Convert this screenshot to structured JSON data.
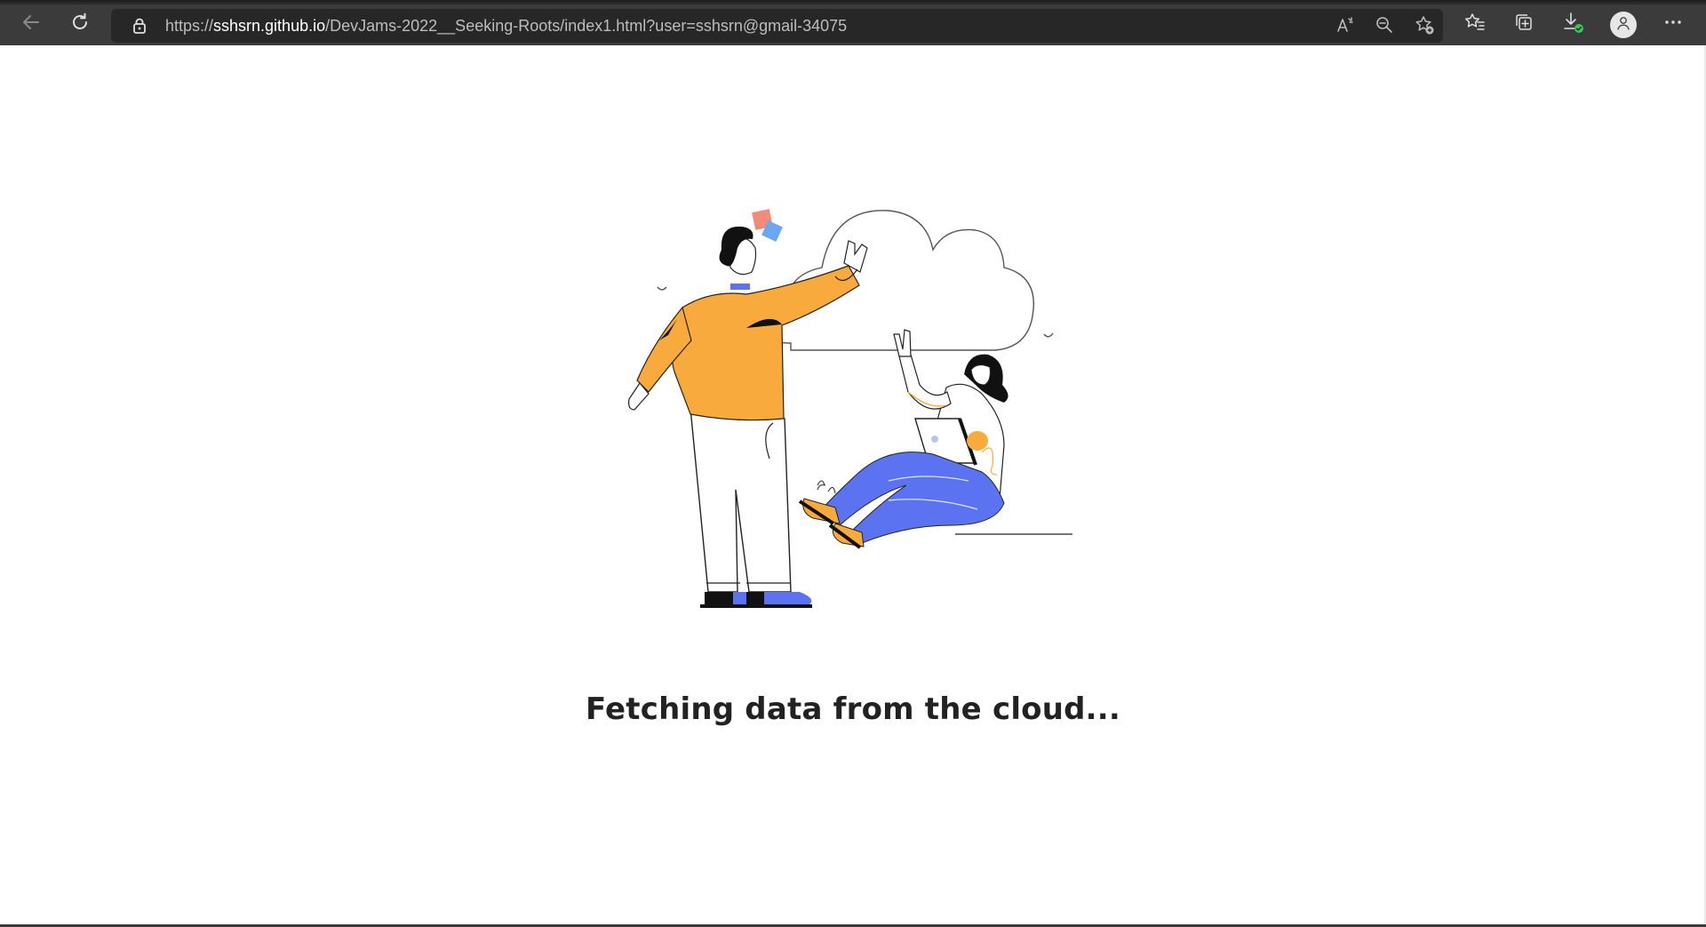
{
  "browser": {
    "url_prefix": "https://",
    "url_host": "sshsrn.github.io",
    "url_path": "/DevJams-2022__Seeking-Roots/index1.html?user=sshsrn@gmail-34075",
    "icons": {
      "back": "arrow-left-icon",
      "refresh": "refresh-icon",
      "lock": "lock-icon",
      "read_aloud": "read-aloud-icon",
      "zoom": "zoom-out-icon",
      "add_favorite": "star-plus-icon",
      "favorites": "favorites-icon",
      "collections": "collections-icon",
      "downloads": "download-icon",
      "profile": "profile-icon",
      "more": "more-icon"
    }
  },
  "page": {
    "status_text": "Fetching data from the cloud..."
  },
  "colors": {
    "orange": "#f9aa3c",
    "blue": "#5b73f0",
    "toolbar": "#3b3b3b",
    "text": "#222222"
  }
}
